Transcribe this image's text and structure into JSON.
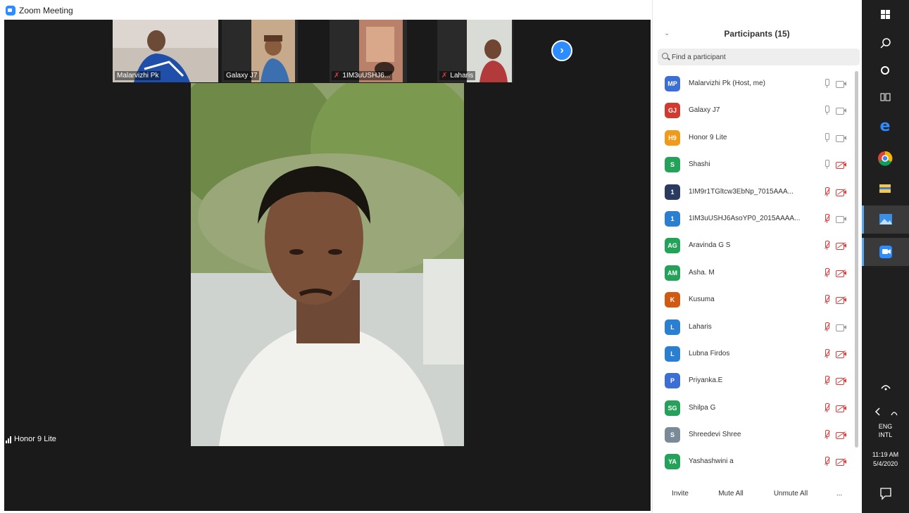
{
  "window": {
    "title": "Zoom Meeting",
    "minimize": "–",
    "maximize": "⧉",
    "close": "✕"
  },
  "thumbnails": [
    {
      "label": "Malarvizhi Pk",
      "muted": false
    },
    {
      "label": "Galaxy J7",
      "muted": false
    },
    {
      "label": "1IM3uUSHJ6...",
      "muted": true
    },
    {
      "label": "Laharis",
      "muted": true
    }
  ],
  "active_speaker": {
    "label": "Honor 9 Lite"
  },
  "participants_panel": {
    "title": "Participants (15)",
    "search_placeholder": "Find a participant",
    "participants": [
      {
        "initials": "MP",
        "name": "Malarvizhi Pk (Host, me)",
        "color": "#3b6fd4",
        "mic_muted": false,
        "video_off": false
      },
      {
        "initials": "GJ",
        "name": "Galaxy J7",
        "color": "#d13a2f",
        "mic_muted": false,
        "video_off": false
      },
      {
        "initials": "H9",
        "name": "Honor 9 Lite",
        "color": "#f09a1a",
        "mic_muted": false,
        "video_off": false
      },
      {
        "initials": "S",
        "name": "Shashi",
        "color": "#25a25a",
        "mic_muted": false,
        "video_off": true
      },
      {
        "initials": "1",
        "name": "1IM9r1TGltcw3EbNp_7015AAA...",
        "color": "#2a3b5f",
        "mic_muted": true,
        "video_off": true
      },
      {
        "initials": "1",
        "name": "1IM3uUSHJ6AsoYP0_2015AAAA...",
        "color": "#2a7fd1",
        "mic_muted": true,
        "video_off": false
      },
      {
        "initials": "AG",
        "name": "Aravinda G S",
        "color": "#25a25a",
        "mic_muted": true,
        "video_off": true
      },
      {
        "initials": "AM",
        "name": "Asha. M",
        "color": "#25a25a",
        "mic_muted": true,
        "video_off": true
      },
      {
        "initials": "K",
        "name": "Kusuma",
        "color": "#d05a12",
        "mic_muted": true,
        "video_off": true
      },
      {
        "initials": "L",
        "name": "Laharis",
        "color": "#2a7fd1",
        "mic_muted": true,
        "video_off": false
      },
      {
        "initials": "L",
        "name": "Lubna Firdos",
        "color": "#2a7fd1",
        "mic_muted": true,
        "video_off": true
      },
      {
        "initials": "P",
        "name": "Priyanka.E",
        "color": "#3b6fd4",
        "mic_muted": true,
        "video_off": true
      },
      {
        "initials": "SG",
        "name": "Shilpa G",
        "color": "#25a25a",
        "mic_muted": true,
        "video_off": true
      },
      {
        "initials": "S",
        "name": "Shreedevi Shree",
        "color": "#7a8a99",
        "mic_muted": true,
        "video_off": true
      },
      {
        "initials": "YA",
        "name": "Yashashwini a",
        "color": "#25a25a",
        "mic_muted": true,
        "video_off": true
      }
    ],
    "footer": {
      "invite": "Invite",
      "mute_all": "Mute All",
      "unmute_all": "Unmute All",
      "more": "..."
    }
  },
  "taskbar": {
    "language_1": "ENG",
    "language_2": "INTL",
    "time": "11:19 AM",
    "date": "5/4/2020"
  }
}
